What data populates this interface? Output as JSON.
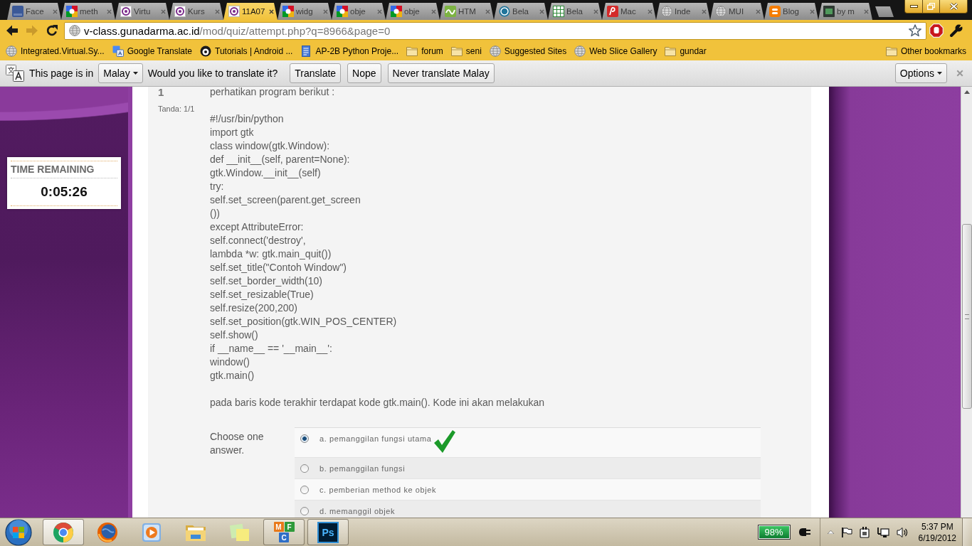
{
  "tabs": [
    {
      "title": "Face",
      "kind": "square",
      "selected": false
    },
    {
      "title": "meth",
      "kind": "blocks",
      "selected": false
    },
    {
      "title": "Virtu",
      "kind": "emblem",
      "selected": false
    },
    {
      "title": "Kurs",
      "kind": "emblem",
      "selected": false
    },
    {
      "title": "11A07",
      "kind": "emblem",
      "selected": true
    },
    {
      "title": "widg",
      "kind": "blocks",
      "selected": false
    },
    {
      "title": "obje",
      "kind": "blocks",
      "selected": false
    },
    {
      "title": "obje",
      "kind": "blocks",
      "selected": false
    },
    {
      "title": "HTM",
      "kind": "wave",
      "selected": false
    },
    {
      "title": "Bela",
      "kind": "circle",
      "selected": false
    },
    {
      "title": "Bela",
      "kind": "sheet",
      "selected": false
    },
    {
      "title": "Mac",
      "kind": "script",
      "selected": false
    },
    {
      "title": "Inde",
      "kind": "globe",
      "selected": false
    },
    {
      "title": "MUI",
      "kind": "globe",
      "selected": false
    },
    {
      "title": "Blog",
      "kind": "rounded",
      "selected": false
    },
    {
      "title": "by m",
      "kind": "image",
      "selected": false
    }
  ],
  "toolbar": {
    "nav": [
      {
        "kind": "back",
        "disabled": false
      },
      {
        "kind": "forward",
        "disabled": true
      },
      {
        "kind": "reload",
        "disabled": false
      }
    ],
    "url_host": "v-class.gunadarma.ac.id",
    "url_path": "/mod/quiz/attempt.php?q=8966&page=0"
  },
  "bookmarks": {
    "items": [
      {
        "label": "Integrated.Virtual.Sy...",
        "kind": "globe"
      },
      {
        "label": "Google Translate",
        "kind": "translate"
      },
      {
        "label": "Tutorials | Android ...",
        "kind": "badge"
      },
      {
        "label": "AP-2B Python Proje...",
        "kind": "document"
      },
      {
        "label": "forum",
        "kind": "folder"
      },
      {
        "label": "seni",
        "kind": "folder"
      },
      {
        "label": "Suggested Sites",
        "kind": "globe"
      },
      {
        "label": "Web Slice Gallery",
        "kind": "globe"
      },
      {
        "label": "gundar",
        "kind": "folder"
      }
    ],
    "other": "Other bookmarks"
  },
  "translate_bar": {
    "lead": "This page is in",
    "language": "Malay",
    "question": "Would you like to translate it?",
    "buttons": [
      "Translate",
      "Nope",
      "Never translate Malay"
    ],
    "options": "Options"
  },
  "timer": {
    "label": "TIME REMAINING",
    "value": "0:05:26"
  },
  "question": {
    "number": "1",
    "grade": "Tanda: 1/1",
    "intro": "perhatikan program berikut :",
    "code_lines": [
      "#!/usr/bin/python",
      "import gtk",
      "class window(gtk.Window):",
      "def __init__(self, parent=None):",
      "gtk.Window.__init__(self)",
      "try:",
      "self.set_screen(parent.get_screen",
      "())",
      "except AttributeError:",
      "self.connect('destroy',",
      "lambda *w: gtk.main_quit())",
      "self.set_title(\"Contoh Window\")",
      "self.set_border_width(10)",
      "self.set_resizable(True)",
      "self.resize(200,200)",
      "self.set_position(gtk.WIN_POS_CENTER)",
      "self.show()",
      "if __name__ == '__main__':",
      "window()",
      "gtk.main()"
    ],
    "prompt": "pada baris kode terakhir terdapat kode gtk.main(). Kode ini akan melakukan",
    "instruction": "Choose one answer.",
    "answers": [
      {
        "label": "a. pemanggilan fungsi utama",
        "selected": true,
        "correct": true
      },
      {
        "label": "b. pemanggilan fungsi",
        "selected": false,
        "correct": false
      },
      {
        "label": "c. pemberian method ke objek",
        "selected": false,
        "correct": false
      },
      {
        "label": "d. memanggil objek",
        "selected": false,
        "correct": false
      }
    ]
  },
  "taskbar": {
    "apps": [
      {
        "kind": "ring",
        "running": true,
        "selected": true
      },
      {
        "kind": "fox",
        "running": false,
        "selected": false
      },
      {
        "kind": "media",
        "running": false,
        "selected": false
      },
      {
        "kind": "folder",
        "running": false,
        "selected": false
      },
      {
        "kind": "notes",
        "running": false,
        "selected": false
      },
      {
        "kind": "blocks",
        "running": true,
        "selected": false,
        "letters": [
          "M",
          "F",
          "C"
        ]
      },
      {
        "kind": "tile",
        "running": true,
        "selected": false,
        "text": "Ps"
      }
    ],
    "battery": "98%",
    "clock": {
      "time": "5:37 PM",
      "date": "6/19/2012"
    }
  }
}
